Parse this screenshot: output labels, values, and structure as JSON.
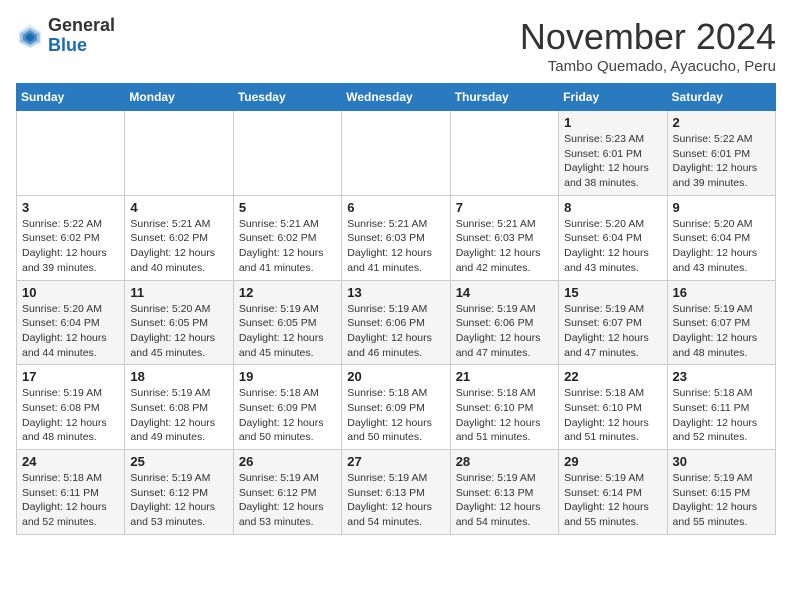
{
  "header": {
    "logo_line1": "General",
    "logo_line2": "Blue",
    "month": "November 2024",
    "location": "Tambo Quemado, Ayacucho, Peru"
  },
  "days_of_week": [
    "Sunday",
    "Monday",
    "Tuesday",
    "Wednesday",
    "Thursday",
    "Friday",
    "Saturday"
  ],
  "weeks": [
    [
      {
        "day": "",
        "info": ""
      },
      {
        "day": "",
        "info": ""
      },
      {
        "day": "",
        "info": ""
      },
      {
        "day": "",
        "info": ""
      },
      {
        "day": "",
        "info": ""
      },
      {
        "day": "1",
        "info": "Sunrise: 5:23 AM\nSunset: 6:01 PM\nDaylight: 12 hours and 38 minutes."
      },
      {
        "day": "2",
        "info": "Sunrise: 5:22 AM\nSunset: 6:01 PM\nDaylight: 12 hours and 39 minutes."
      }
    ],
    [
      {
        "day": "3",
        "info": "Sunrise: 5:22 AM\nSunset: 6:02 PM\nDaylight: 12 hours and 39 minutes."
      },
      {
        "day": "4",
        "info": "Sunrise: 5:21 AM\nSunset: 6:02 PM\nDaylight: 12 hours and 40 minutes."
      },
      {
        "day": "5",
        "info": "Sunrise: 5:21 AM\nSunset: 6:02 PM\nDaylight: 12 hours and 41 minutes."
      },
      {
        "day": "6",
        "info": "Sunrise: 5:21 AM\nSunset: 6:03 PM\nDaylight: 12 hours and 41 minutes."
      },
      {
        "day": "7",
        "info": "Sunrise: 5:21 AM\nSunset: 6:03 PM\nDaylight: 12 hours and 42 minutes."
      },
      {
        "day": "8",
        "info": "Sunrise: 5:20 AM\nSunset: 6:04 PM\nDaylight: 12 hours and 43 minutes."
      },
      {
        "day": "9",
        "info": "Sunrise: 5:20 AM\nSunset: 6:04 PM\nDaylight: 12 hours and 43 minutes."
      }
    ],
    [
      {
        "day": "10",
        "info": "Sunrise: 5:20 AM\nSunset: 6:04 PM\nDaylight: 12 hours and 44 minutes."
      },
      {
        "day": "11",
        "info": "Sunrise: 5:20 AM\nSunset: 6:05 PM\nDaylight: 12 hours and 45 minutes."
      },
      {
        "day": "12",
        "info": "Sunrise: 5:19 AM\nSunset: 6:05 PM\nDaylight: 12 hours and 45 minutes."
      },
      {
        "day": "13",
        "info": "Sunrise: 5:19 AM\nSunset: 6:06 PM\nDaylight: 12 hours and 46 minutes."
      },
      {
        "day": "14",
        "info": "Sunrise: 5:19 AM\nSunset: 6:06 PM\nDaylight: 12 hours and 47 minutes."
      },
      {
        "day": "15",
        "info": "Sunrise: 5:19 AM\nSunset: 6:07 PM\nDaylight: 12 hours and 47 minutes."
      },
      {
        "day": "16",
        "info": "Sunrise: 5:19 AM\nSunset: 6:07 PM\nDaylight: 12 hours and 48 minutes."
      }
    ],
    [
      {
        "day": "17",
        "info": "Sunrise: 5:19 AM\nSunset: 6:08 PM\nDaylight: 12 hours and 48 minutes."
      },
      {
        "day": "18",
        "info": "Sunrise: 5:19 AM\nSunset: 6:08 PM\nDaylight: 12 hours and 49 minutes."
      },
      {
        "day": "19",
        "info": "Sunrise: 5:18 AM\nSunset: 6:09 PM\nDaylight: 12 hours and 50 minutes."
      },
      {
        "day": "20",
        "info": "Sunrise: 5:18 AM\nSunset: 6:09 PM\nDaylight: 12 hours and 50 minutes."
      },
      {
        "day": "21",
        "info": "Sunrise: 5:18 AM\nSunset: 6:10 PM\nDaylight: 12 hours and 51 minutes."
      },
      {
        "day": "22",
        "info": "Sunrise: 5:18 AM\nSunset: 6:10 PM\nDaylight: 12 hours and 51 minutes."
      },
      {
        "day": "23",
        "info": "Sunrise: 5:18 AM\nSunset: 6:11 PM\nDaylight: 12 hours and 52 minutes."
      }
    ],
    [
      {
        "day": "24",
        "info": "Sunrise: 5:18 AM\nSunset: 6:11 PM\nDaylight: 12 hours and 52 minutes."
      },
      {
        "day": "25",
        "info": "Sunrise: 5:19 AM\nSunset: 6:12 PM\nDaylight: 12 hours and 53 minutes."
      },
      {
        "day": "26",
        "info": "Sunrise: 5:19 AM\nSunset: 6:12 PM\nDaylight: 12 hours and 53 minutes."
      },
      {
        "day": "27",
        "info": "Sunrise: 5:19 AM\nSunset: 6:13 PM\nDaylight: 12 hours and 54 minutes."
      },
      {
        "day": "28",
        "info": "Sunrise: 5:19 AM\nSunset: 6:13 PM\nDaylight: 12 hours and 54 minutes."
      },
      {
        "day": "29",
        "info": "Sunrise: 5:19 AM\nSunset: 6:14 PM\nDaylight: 12 hours and 55 minutes."
      },
      {
        "day": "30",
        "info": "Sunrise: 5:19 AM\nSunset: 6:15 PM\nDaylight: 12 hours and 55 minutes."
      }
    ]
  ]
}
